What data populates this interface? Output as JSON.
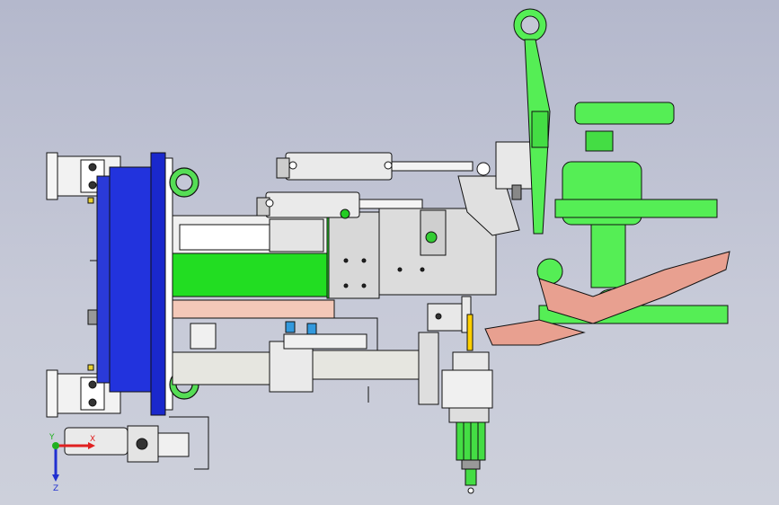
{
  "viewport": {
    "background_top": "#b4b8cc",
    "background_bottom": "#cdd0db"
  },
  "triad": {
    "x_label": "X",
    "y_label": "Y",
    "z_label": "Z",
    "x_color": "#e02020",
    "y_color": "#20b020",
    "z_color": "#2030d0"
  },
  "model": {
    "colors": {
      "mount_plate": "#2233dd",
      "bracket": "#f2f2f2",
      "frame_green": "#22dd22",
      "cylinder": "#e8e8e8",
      "gripper_green": "#55ee55",
      "finger_pink": "#e8a090",
      "pad_pink": "#f4c8b8",
      "beam": "#e6e6e0",
      "outline": "#111111"
    }
  }
}
